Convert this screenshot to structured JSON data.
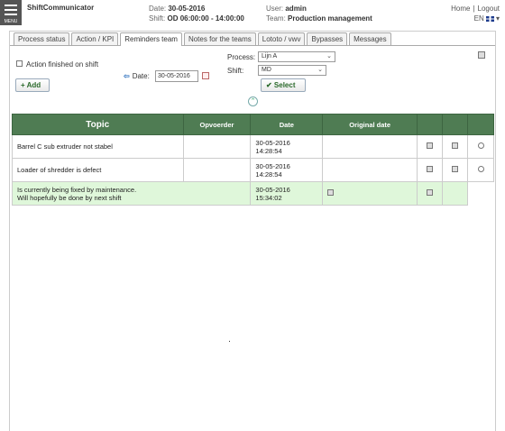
{
  "header": {
    "menu_label": "MENU",
    "app_title": "ShiftCommunicator",
    "date_label": "Date:",
    "date_value": "30-05-2016",
    "shift_label": "Shift:",
    "shift_value": "OD  06:00:00 - 14:00:00",
    "user_label": "User:",
    "user_value": "admin",
    "team_label": "Team:",
    "team_value": "Production management",
    "home_link": "Home",
    "logout_link": "Logout",
    "lang": "EN"
  },
  "tabs": [
    {
      "label": "Process status"
    },
    {
      "label": "Action / KPI"
    },
    {
      "label": "Reminders team"
    },
    {
      "label": "Notes for the teams"
    },
    {
      "label": "Lototo / vwv"
    },
    {
      "label": "Bypasses"
    },
    {
      "label": "Messages"
    }
  ],
  "form": {
    "action_finished_label": "Action finished on shift",
    "add_button": "+ Add",
    "date_label": "Date:",
    "date_value": "30-05-2016",
    "process_label": "Process:",
    "process_value": "Lijn A",
    "shift_label": "Shift:",
    "shift_value": "MD",
    "select_button": "✔ Select"
  },
  "table": {
    "headers": [
      "Topic",
      "Opvoerder",
      "Date",
      "Original date",
      "",
      "",
      ""
    ],
    "rows": [
      {
        "topic": "Barrel C sub extruder  not stabel",
        "opvoerder": "",
        "date_line1": "30-05-2016",
        "date_line2": "14:28:54",
        "original_date": ""
      },
      {
        "topic": "Loader of shredder is defect",
        "opvoerder": "",
        "date_line1": "30-05-2016",
        "date_line2": "14:28:54",
        "original_date": ""
      }
    ],
    "highlight_row": {
      "line1": "Is currently being fixed by maintenance.",
      "line2": "Will hopefully be done by next shift",
      "date_line1": "30-05-2016",
      "date_line2": "15:34:02"
    }
  },
  "colors": {
    "header_green": "#4f7c53",
    "highlight_green": "#dff7da"
  }
}
